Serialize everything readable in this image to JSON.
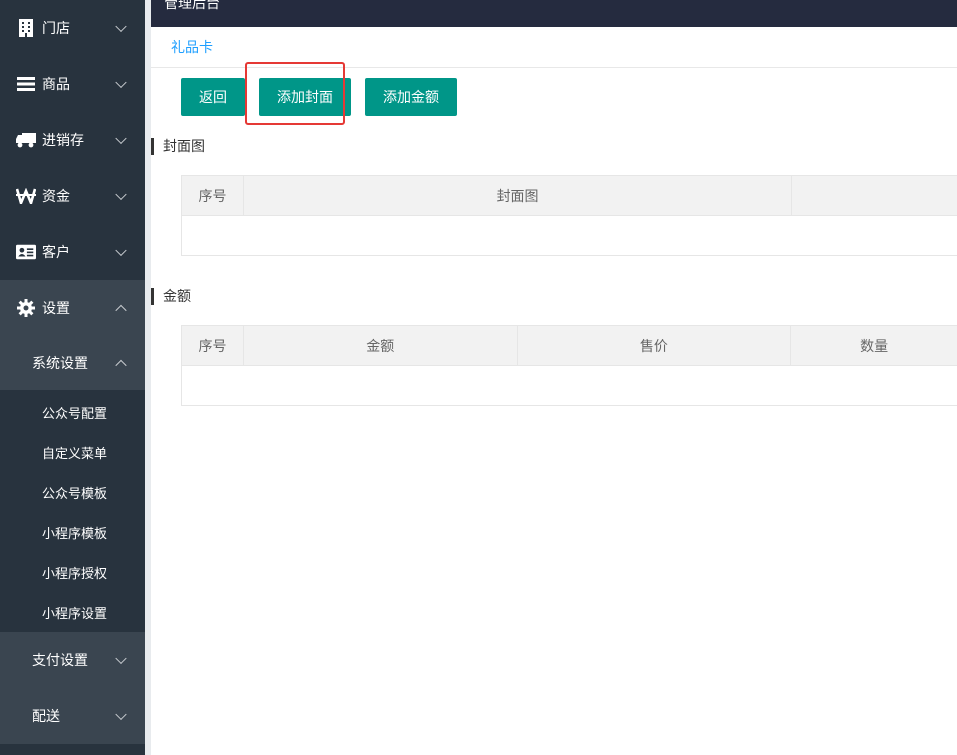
{
  "sidebar": {
    "top_items": [
      {
        "label": "门店",
        "icon": "building-icon"
      },
      {
        "label": "商品",
        "icon": "list-icon"
      },
      {
        "label": "进销存",
        "icon": "truck-icon"
      },
      {
        "label": "资金",
        "icon": "won-icon"
      },
      {
        "label": "客户",
        "icon": "id-card-icon"
      },
      {
        "label": "设置",
        "icon": "gear-icon"
      }
    ],
    "sub_system": "系统设置",
    "leaves": [
      "公众号配置",
      "自定义菜单",
      "公众号模板",
      "小程序模板",
      "小程序授权",
      "小程序设置"
    ],
    "sub_payment": "支付设置",
    "sub_delivery": "配送"
  },
  "header": {
    "partial_title": "管理后台"
  },
  "tabs": {
    "active": "礼品卡"
  },
  "buttons": {
    "back": "返回",
    "add_cover": "添加封面",
    "add_amount": "添加金额"
  },
  "cover_section": {
    "title": "封面图",
    "columns": [
      "序号",
      "封面图",
      ""
    ]
  },
  "amount_section": {
    "title": "金额",
    "columns": [
      "序号",
      "金额",
      "售价",
      "数量"
    ]
  },
  "colors": {
    "sidebar_bg": "#28333e",
    "sidebar_open_bg": "#3a4550",
    "primary_button": "#009688",
    "tab_active": "#1e9fff",
    "highlight": "#e53935"
  }
}
